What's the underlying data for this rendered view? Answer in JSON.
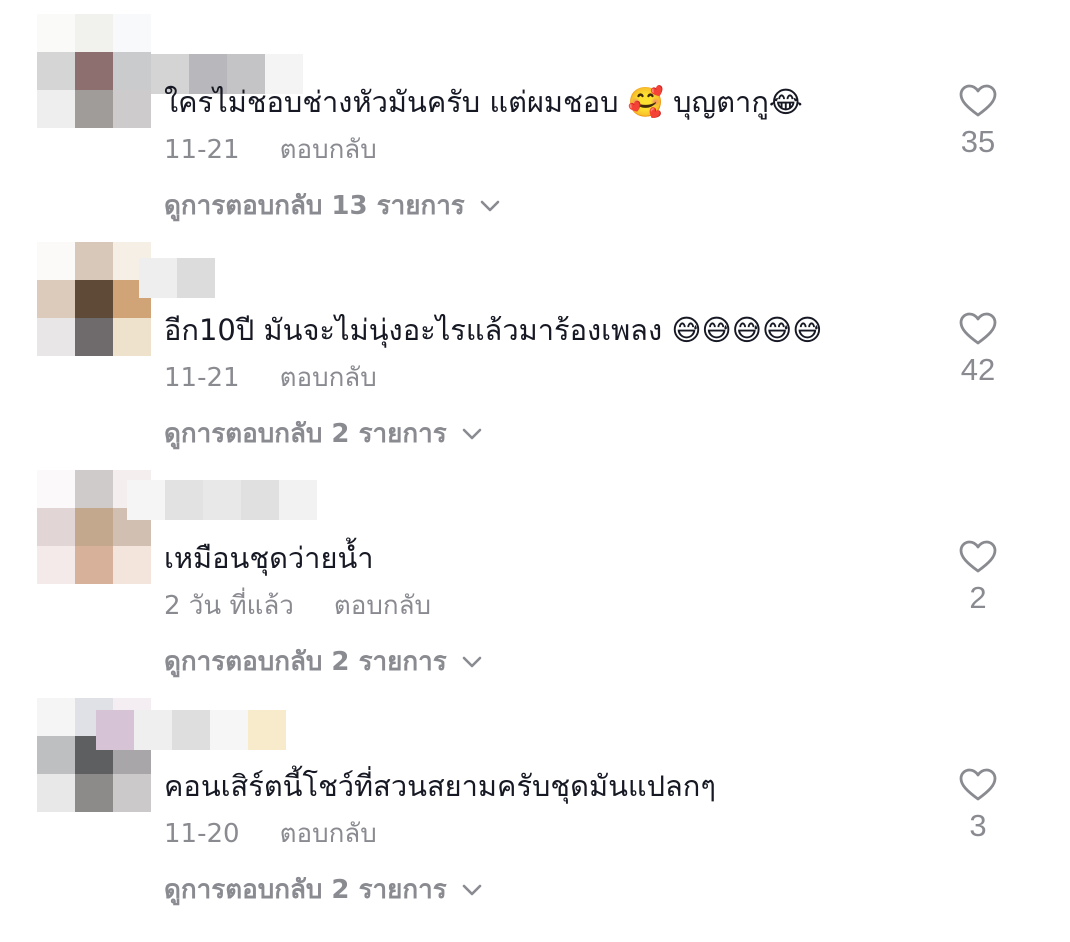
{
  "comments": [
    {
      "text": "ใครไม่ชอบช่างหัวมันครับ แต่ผมชอบ 🥰 บุญตากู😂",
      "date": "11-21",
      "reply_label": "ตอบกลับ",
      "view_replies": "ดูการตอบกลับ 13 รายการ",
      "likes": "35",
      "avatar_colors": [
        "#fafaf8",
        "#f1f1ee",
        "#f8f9fa",
        "#d5d5d5",
        "#8e6f70",
        "#c9cbcc",
        "#eeeeee",
        "#a09c99",
        "#cdcbcb"
      ],
      "name_colors": [
        "#d4d4d4",
        "#b8b8bc",
        "#c4c4c6",
        "#f4f4f4"
      ]
    },
    {
      "text": "อีก10ปี มันจะไม่นุ่งอะไรแล้วมาร้องเพลง 😅😅😅😅😅",
      "date": "11-21",
      "reply_label": "ตอบกลับ",
      "view_replies": "ดูการตอบกลับ 2 รายการ",
      "likes": "42",
      "avatar_colors": [
        "#fbfaf8",
        "#d8c8b9",
        "#f5efe5",
        "#dccbbb",
        "#5e4a36",
        "#d1a478",
        "#e8e6e6",
        "#6f6a6b",
        "#efe2cd"
      ],
      "name_colors": [
        "#eeeeee",
        "#dcdcdc"
      ]
    },
    {
      "text": "เหมือนชุดว่ายน้ำ",
      "date": "2 วัน ที่แล้ว",
      "reply_label": "ตอบกลับ",
      "view_replies": "ดูการตอบกลับ 2 รายการ",
      "likes": "2",
      "avatar_colors": [
        "#fbf9f9",
        "#cfcbca",
        "#f4eeee",
        "#e2d5d5",
        "#c4a88d",
        "#d1c0b2",
        "#f4eaea",
        "#d8b19b",
        "#f4e5dc"
      ],
      "name_colors": [
        "#f5f5f5",
        "#e2e2e2",
        "#e8e8e8",
        "#e0e0e0",
        "#f2f2f2"
      ]
    },
    {
      "text": "คอนเสิร์ตนี้โชว์ที่สวนสยามครับชุดมันแปลกๆ",
      "date": "11-20",
      "reply_label": "ตอบกลับ",
      "view_replies": "ดูการตอบกลับ 2 รายการ",
      "likes": "3",
      "avatar_colors": [
        "#f5f5f5",
        "#dfe1e6",
        "#f4eef2",
        "#bdbfc0",
        "#5d5f61",
        "#a9a6aa",
        "#e8e8e8",
        "#8d8b8a",
        "#cbc9c9"
      ],
      "name_colors": [
        "#d7c3d6",
        "#efefef",
        "#dedede",
        "#f6f6f6",
        "#f7ebcc"
      ]
    }
  ],
  "icons": {
    "like": "heart-outline-icon",
    "expand": "chevron-down-icon"
  },
  "colors": {
    "text": "#161823",
    "secondary": "#8a8b91",
    "background": "#ffffff"
  }
}
